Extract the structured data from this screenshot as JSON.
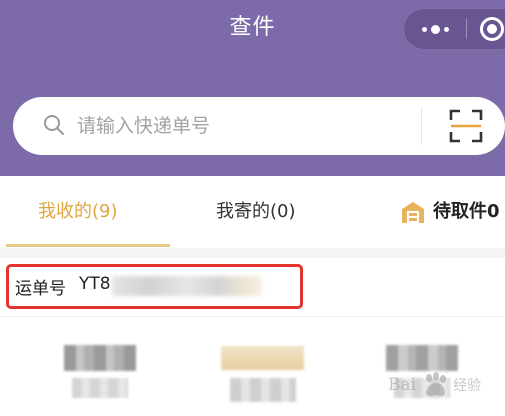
{
  "header": {
    "title": "查件",
    "capsule": {
      "more_icon": "ellipsis-icon",
      "close_icon": "record-circle-icon"
    }
  },
  "search": {
    "placeholder": "请输入快递单号",
    "value": "",
    "search_icon": "search-icon",
    "scan_icon": "scan-icon"
  },
  "tabs": [
    {
      "label": "我收的(9)",
      "active": true
    },
    {
      "label": "我寄的(0)",
      "active": false
    },
    {
      "label": "待取件0",
      "active": false,
      "icon": "parcel-locker-icon"
    }
  ],
  "waybill": {
    "label": "运单号",
    "number_prefix": "YT8"
  },
  "watermark": {
    "brand": "Bai",
    "brand_suffix": "经验"
  },
  "colors": {
    "header_bg": "#7d6aa8",
    "active_tab": "#e0a63e",
    "tab_underline": "#e7c78a",
    "highlight_box": "#e5342d"
  }
}
